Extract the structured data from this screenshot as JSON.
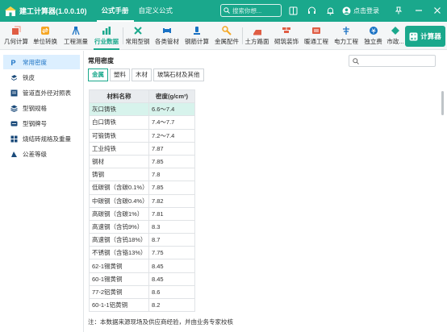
{
  "app": {
    "title": "建工计算器(1.0.0.10)",
    "tabs": [
      "公式手册",
      "自定义公式"
    ],
    "search_placeholder": "搜索你想...",
    "login_label": "点击登录",
    "brand_color": "#1aa88c"
  },
  "toolbar": {
    "items": [
      {
        "label": "几何计算",
        "icon": "geometry-icon",
        "color": "#e05d44"
      },
      {
        "label": "单位转换",
        "icon": "unit-convert-icon",
        "color": "#f5a623"
      },
      {
        "label": "工程测量",
        "icon": "survey-icon",
        "color": "#1a72c4"
      },
      {
        "label": "行业数据",
        "icon": "industry-data-icon",
        "color": "#1aa88c"
      },
      {
        "label": "常用型钢",
        "icon": "steel-section-icon",
        "color": "#1aa88c"
      },
      {
        "label": "各类管材",
        "icon": "pipe-icon",
        "color": "#1a72c4"
      },
      {
        "label": "钢筋计算",
        "icon": "rebar-icon",
        "color": "#1a72c4"
      },
      {
        "label": "金属配件",
        "icon": "metal-fitting-icon",
        "color": "#f5a623"
      },
      {
        "label": "土方路面",
        "icon": "earthwork-icon",
        "color": "#e05d44"
      },
      {
        "label": "砌筑装饰",
        "icon": "masonry-icon",
        "color": "#e05d44"
      },
      {
        "label": "暖通工程",
        "icon": "hvac-icon",
        "color": "#e05d44"
      },
      {
        "label": "电力工程",
        "icon": "power-icon",
        "color": "#1a72c4"
      },
      {
        "label": "独立费",
        "icon": "fee-icon",
        "color": "#1a72c4"
      },
      {
        "label": "市政...",
        "icon": "municipal-icon",
        "color": "#1aa88c"
      }
    ],
    "calc_button": "计算器"
  },
  "sidebar": {
    "items": [
      {
        "label": "常用密度",
        "icon": "density-icon"
      },
      {
        "label": "铁皮",
        "icon": "sheet-metal-icon"
      },
      {
        "label": "管道直外径对照表",
        "icon": "pipe-table-icon"
      },
      {
        "label": "型钢规格",
        "icon": "layers-icon"
      },
      {
        "label": "型钢牌号",
        "icon": "grade-icon"
      },
      {
        "label": "烧结砖规格及重量",
        "icon": "brick-icon"
      },
      {
        "label": "公差等级",
        "icon": "tolerance-icon"
      }
    ]
  },
  "main": {
    "section_title": "常用密度",
    "search_placeholder": "",
    "tabs": [
      "金属",
      "塑料",
      "木材",
      "玻璃石材及其他"
    ],
    "table": {
      "headers": [
        "材料名称",
        "密度(g/cm³)"
      ],
      "rows": [
        [
          "灰口铸铁",
          "6.6～7.4"
        ],
        [
          "白口铸铁",
          "7.4～7.7"
        ],
        [
          "可锻铸铁",
          "7.2～7.4"
        ],
        [
          "工业纯铁",
          "7.87"
        ],
        [
          "钢材",
          "7.85"
        ],
        [
          "铸钢",
          "7.8"
        ],
        [
          "低碳钢（含碳0.1%）",
          "7.85"
        ],
        [
          "中碳钢（含碳0.4%）",
          "7.82"
        ],
        [
          "高碳钢（含碳1%）",
          "7.81"
        ],
        [
          "高速钢（含钨9%）",
          "8.3"
        ],
        [
          "高速钢（含钨18%）",
          "8.7"
        ],
        [
          "不锈钢（含铬13%）",
          "7.75"
        ],
        [
          "62-1锡黄铜",
          "8.45"
        ],
        [
          "60-1锡黄铜",
          "8.45"
        ],
        [
          "77-2铝黄铜",
          "8.6"
        ],
        [
          "60-1-1铝黄铜",
          "8.2"
        ]
      ]
    },
    "note": "注：本数据来源现场及供应商经验，并由业务专家校核"
  }
}
